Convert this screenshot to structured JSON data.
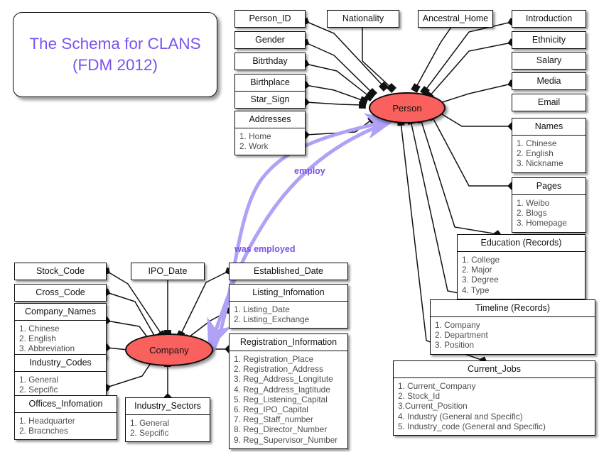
{
  "title": {
    "line1": "The Schema for CLANS",
    "line2": "(FDM 2012)",
    "color": "#7b52f0"
  },
  "entities": {
    "person": {
      "label": "Person",
      "color": "#f9605e"
    },
    "company": {
      "label": "Company",
      "color": "#f9605e"
    }
  },
  "relationships": [
    {
      "label": "employ",
      "from": "Company",
      "to": "Person",
      "color": "#7b4fe8"
    },
    {
      "label": "was employed",
      "from": "Person",
      "to": "Company",
      "color": "#7b4fe8"
    }
  ],
  "person_attributes": [
    {
      "name": "Person_ID",
      "items": []
    },
    {
      "name": "Gender",
      "items": []
    },
    {
      "name": "Bitrthday",
      "items": []
    },
    {
      "name": "Birthplace",
      "items": []
    },
    {
      "name": "Star_Sign",
      "items": []
    },
    {
      "name": "Addresses",
      "items": [
        "1. Home",
        "2. Work"
      ]
    },
    {
      "name": "Nationality",
      "items": []
    },
    {
      "name": "Ancestral_Home",
      "items": []
    },
    {
      "name": "Introduction",
      "items": []
    },
    {
      "name": "Ethnicity",
      "items": []
    },
    {
      "name": "Salary",
      "items": []
    },
    {
      "name": "Media",
      "items": []
    },
    {
      "name": "Email",
      "items": []
    },
    {
      "name": "Names",
      "items": [
        "1. Chinese",
        "2. English",
        "3. Nickname"
      ]
    },
    {
      "name": "Pages",
      "items": [
        "1. Weibo",
        "2. Blogs",
        "3. Homepage"
      ]
    },
    {
      "name": "Education (Records)",
      "items": [
        "1. College",
        "2. Major",
        "3. Degree",
        "4. Type"
      ]
    },
    {
      "name": "Timeline (Records)",
      "items": [
        "1. Company",
        "2. Department",
        "3. Position"
      ]
    },
    {
      "name": "Current_Jobs",
      "items": [
        "1. Current_Company",
        "2. Stock_Id",
        "3.Current_Position",
        "4. Industry (General and Specific)",
        "5. Industry_code (General and Specific)"
      ]
    }
  ],
  "company_attributes": [
    {
      "name": "Stock_Code",
      "items": []
    },
    {
      "name": "Cross_Code",
      "items": []
    },
    {
      "name": "Company_Names",
      "items": [
        "1. Chinese",
        "2. English",
        "3. Abbreviation"
      ]
    },
    {
      "name": "Industry_Codes",
      "items": [
        "1. General",
        "2. Sepcific"
      ]
    },
    {
      "name": "Offices_Infomation",
      "items": [
        "1. Headquarter",
        "2. Bracnches"
      ]
    },
    {
      "name": "IPO_Date",
      "items": []
    },
    {
      "name": "Industry_Sectors",
      "items": [
        "1. General",
        "2. Sepcific"
      ]
    },
    {
      "name": "Established_Date",
      "items": []
    },
    {
      "name": "Listing_Infomation",
      "items": [
        "1. Listing_Date",
        "2. Listing_Exchange"
      ]
    },
    {
      "name": "Registration_Information",
      "items": [
        "1. Registration_Place",
        "2. Registration_Address",
        "3. Reg_Address_Longitute",
        "4. Reg_Address_lagtitude",
        "5. Reg_Listening_Capital",
        "6. Reg_IPO_Capital",
        "7. Reg_Staff_number",
        "8. Reg_Director_Number",
        "9. Reg_Supervisor_Number"
      ]
    }
  ]
}
